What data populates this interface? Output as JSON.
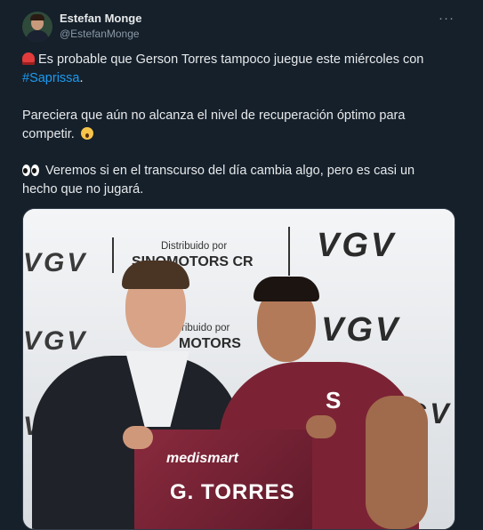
{
  "tweet": {
    "author_name": "Estefan Monge",
    "author_handle": "@EstefanMonge",
    "more_label": "···",
    "paragraph1_text": "Es probable que Gerson Torres tampoco juegue este miércoles con",
    "paragraph1_hashtag": "#Saprissa",
    "paragraph1_end": ".",
    "paragraph2_text": "Pareciera que aún no alcanza el nivel de recuperación óptimo para competir.",
    "paragraph3_text": "Veremos si en el transcurso del día cambia algo, pero es casi un hecho que no jugará."
  },
  "icons": {
    "avatar": "avatar",
    "more": "more-options-icon",
    "siren": "rotating-light-emoji",
    "scream": "face-screaming-emoji",
    "eyes": "eyes-emoji"
  },
  "colors": {
    "background": "#15202b",
    "text": "#e7e9ea",
    "secondary_text": "#8b98a5",
    "link": "#1d9bf0"
  },
  "media": {
    "backdrop_logo": "VGV",
    "backdrop_distribuido": "Distribuido por",
    "backdrop_brand_1": "SINOMOTORS CR",
    "backdrop_brand_2": "MOTORS",
    "backdrop_distribuido_partial": "ribuido por",
    "jersey_sponsor": "medismart",
    "jersey_name": "G. TORRES",
    "chest_letter": "S"
  }
}
